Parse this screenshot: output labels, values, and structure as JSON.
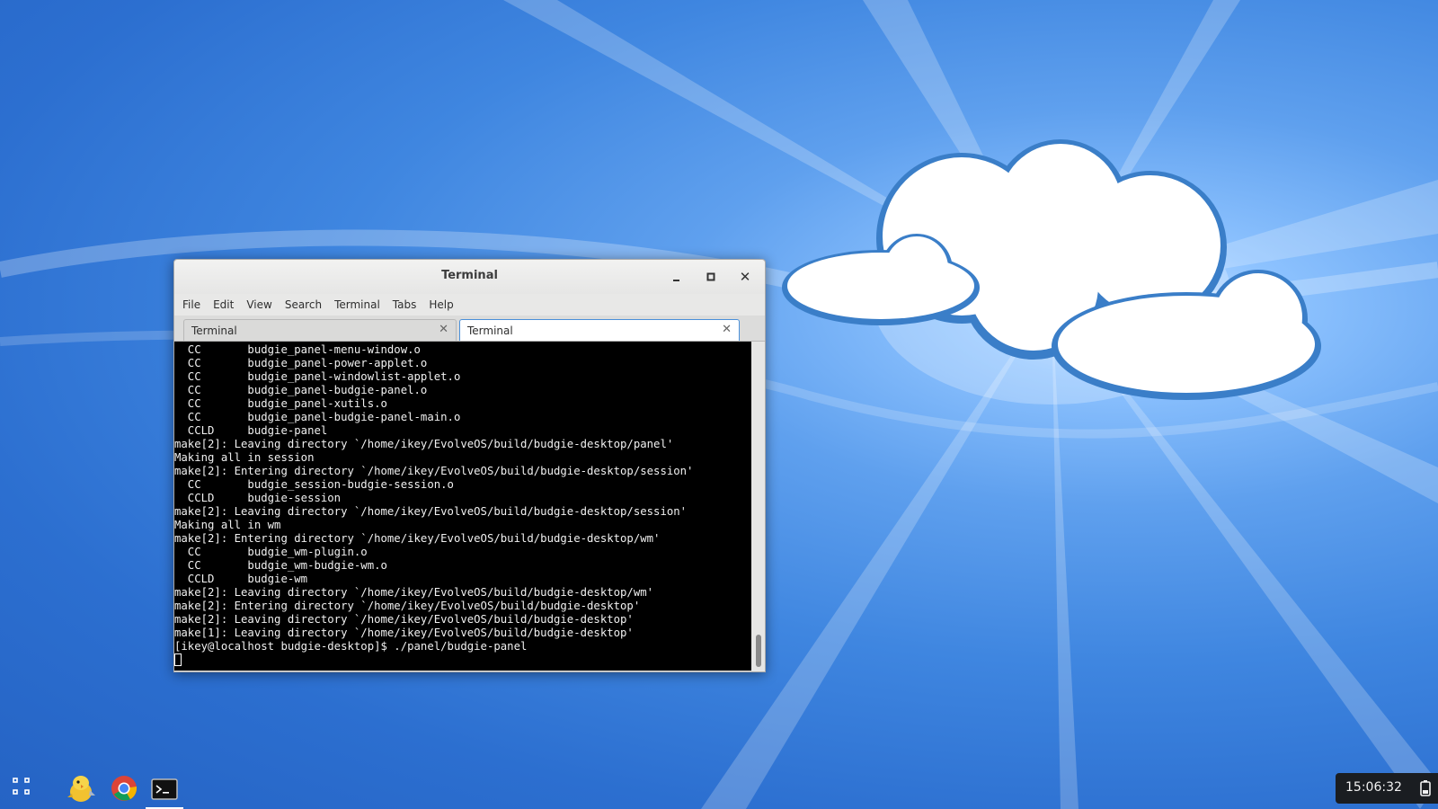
{
  "window": {
    "title": "Terminal",
    "menu": [
      "File",
      "Edit",
      "View",
      "Search",
      "Terminal",
      "Tabs",
      "Help"
    ],
    "tabs": [
      {
        "label": "Terminal",
        "active": false
      },
      {
        "label": "Terminal",
        "active": true
      }
    ],
    "close_glyph": "✕"
  },
  "terminal": {
    "lines": [
      "  CC       budgie_panel-menu-window.o",
      "  CC       budgie_panel-power-applet.o",
      "  CC       budgie_panel-windowlist-applet.o",
      "  CC       budgie_panel-budgie-panel.o",
      "  CC       budgie_panel-xutils.o",
      "  CC       budgie_panel-budgie-panel-main.o",
      "  CCLD     budgie-panel",
      "make[2]: Leaving directory `/home/ikey/EvolveOS/build/budgie-desktop/panel'",
      "Making all in session",
      "make[2]: Entering directory `/home/ikey/EvolveOS/build/budgie-desktop/session'",
      "  CC       budgie_session-budgie-session.o",
      "  CCLD     budgie-session",
      "make[2]: Leaving directory `/home/ikey/EvolveOS/build/budgie-desktop/session'",
      "Making all in wm",
      "make[2]: Entering directory `/home/ikey/EvolveOS/build/budgie-desktop/wm'",
      "  CC       budgie_wm-plugin.o",
      "  CC       budgie_wm-budgie-wm.o",
      "  CCLD     budgie-wm",
      "make[2]: Leaving directory `/home/ikey/EvolveOS/build/budgie-desktop/wm'",
      "make[2]: Entering directory `/home/ikey/EvolveOS/build/budgie-desktop'",
      "make[2]: Leaving directory `/home/ikey/EvolveOS/build/budgie-desktop'",
      "make[1]: Leaving directory `/home/ikey/EvolveOS/build/budgie-desktop'",
      "[ikey@localhost budgie-desktop]$ ./panel/budgie-panel"
    ]
  },
  "panel": {
    "clock": "15:06:32",
    "apps": [
      "budgie-icon",
      "chrome-icon",
      "terminal-icon"
    ],
    "active_app": "terminal-icon"
  },
  "colors": {
    "desktop": "#3f86e0",
    "terminal_bg": "#000000",
    "panel_clock_bg": "#1a1d21",
    "active_tab_border": "#4a90d9"
  }
}
